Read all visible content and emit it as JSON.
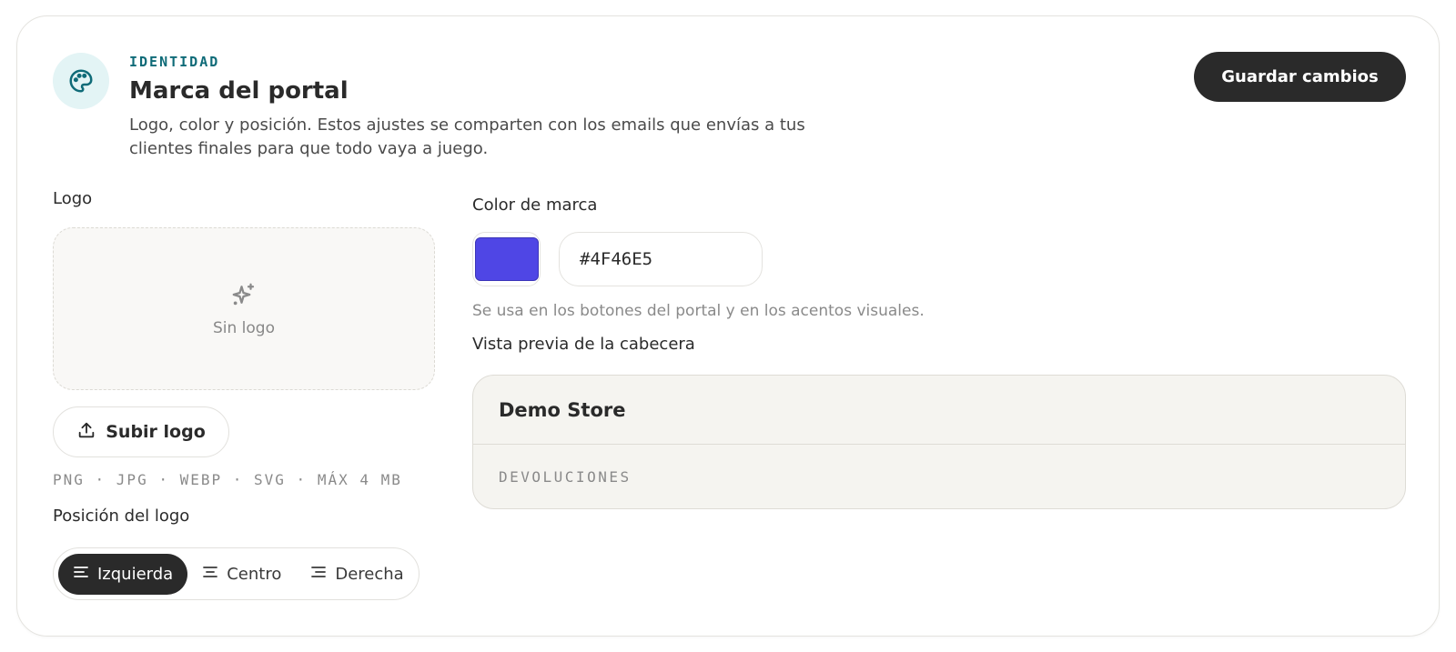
{
  "header": {
    "icon": "palette-icon",
    "eyebrow": "IDENTIDAD",
    "title": "Marca del portal",
    "description": "Logo, color y posición. Estos ajustes se comparten con los emails que envías a tus clientes finales para que todo vaya a juego.",
    "save_label": "Guardar cambios"
  },
  "logo": {
    "label": "Logo",
    "empty_icon": "sparkle-icon",
    "empty_text": "Sin logo",
    "upload_icon": "upload-icon",
    "upload_label": "Subir logo",
    "formats": "PNG · JPG · WEBP · SVG · MÁX 4 MB"
  },
  "position": {
    "label": "Posición del logo",
    "options": [
      {
        "label": "Izquierda",
        "icon": "align-left-icon",
        "selected": true
      },
      {
        "label": "Centro",
        "icon": "align-center-icon",
        "selected": false
      },
      {
        "label": "Derecha",
        "icon": "align-right-icon",
        "selected": false
      }
    ]
  },
  "color": {
    "label": "Color de marca",
    "value": "#4F46E5",
    "help": "Se usa en los botones del portal y en los acentos visuales."
  },
  "preview": {
    "label": "Vista previa de la cabecera",
    "store_name": "Demo Store",
    "section": "DEVOLUCIONES"
  },
  "colors": {
    "accent_teal": "#0f6b78",
    "dark": "#2a2a2a",
    "brand": "#4F46E5"
  }
}
